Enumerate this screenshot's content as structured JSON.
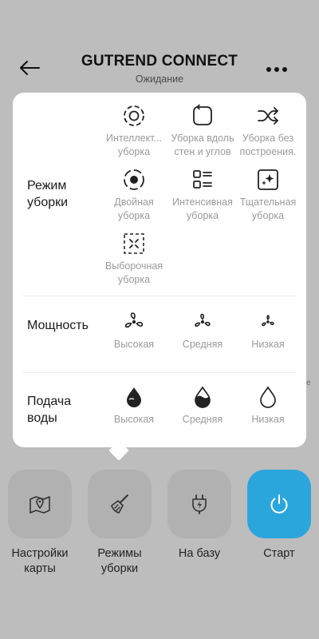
{
  "header": {
    "title": "GUTREND CONNECT",
    "status": "Ожидание"
  },
  "background_hint": "е",
  "popup": {
    "cleaning_mode": {
      "label_line1": "Режим",
      "label_line2": "уборки",
      "options": [
        {
          "l1": "Интеллект...",
          "l2": "уборка",
          "icon": "smart-clean-icon"
        },
        {
          "l1": "Уборка вдоль",
          "l2": "стен и углов",
          "icon": "edge-clean-icon"
        },
        {
          "l1": "Уборка без",
          "l2": "построения.",
          "icon": "random-clean-icon"
        },
        {
          "l1": "Двойная",
          "l2": "уборка",
          "icon": "double-clean-icon"
        },
        {
          "l1": "Интенсивная",
          "l2": "уборка",
          "icon": "intensive-clean-icon"
        },
        {
          "l1": "Тщательная",
          "l2": "уборка",
          "icon": "thorough-clean-icon"
        },
        {
          "l1": "Выборочная",
          "l2": "уборка",
          "icon": "spot-clean-icon"
        }
      ]
    },
    "power": {
      "label": "Мощность",
      "options": [
        {
          "label": "Высокая",
          "icon": "fan-high-icon"
        },
        {
          "label": "Средняя",
          "icon": "fan-medium-icon"
        },
        {
          "label": "Низкая",
          "icon": "fan-low-icon"
        }
      ]
    },
    "water": {
      "label_line1": "Подача",
      "label_line2": "воды",
      "options": [
        {
          "label": "Высокая",
          "icon": "water-high-icon"
        },
        {
          "label": "Средняя",
          "icon": "water-medium-icon"
        },
        {
          "label": "Низкая",
          "icon": "water-low-icon"
        }
      ]
    }
  },
  "bottom": {
    "map_settings": {
      "l1": "Настройки",
      "l2": "карты"
    },
    "cleaning_modes": {
      "l1": "Режимы",
      "l2": "уборки"
    },
    "to_base": "На базу",
    "start": "Старт"
  },
  "colors": {
    "background": "#bdbdbd",
    "accent": "#2ba6dd",
    "muted_text": "#9a9a9a"
  }
}
